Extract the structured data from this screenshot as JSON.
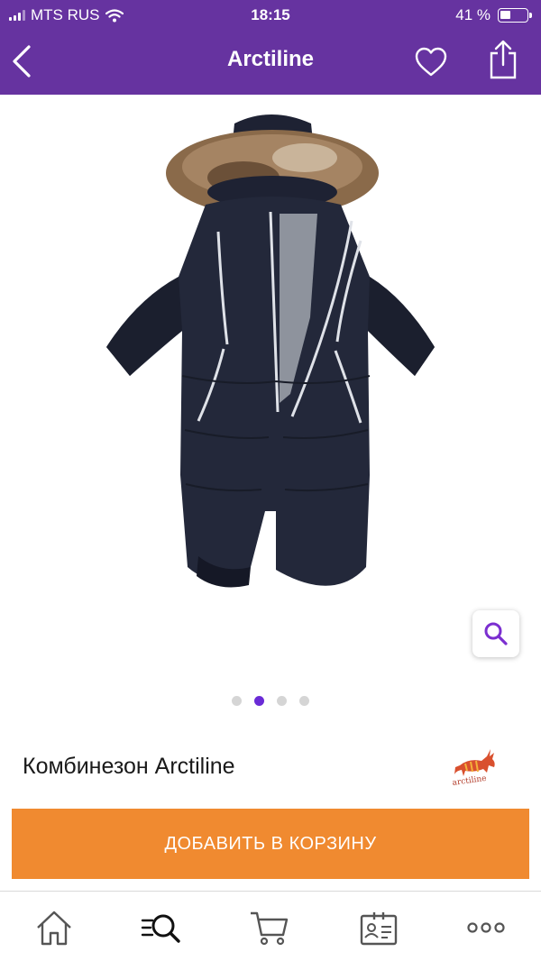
{
  "status_bar": {
    "carrier": "MTS RUS",
    "time": "18:15",
    "battery_percent": "41 %",
    "battery_level": 0.41
  },
  "nav": {
    "title": "Arctiline",
    "back_icon": "chevron-left-icon",
    "favorite_icon": "heart-icon",
    "share_icon": "share-icon"
  },
  "gallery": {
    "image_subject": "kids-winter-snowsuit",
    "slides": [
      "1",
      "2",
      "3",
      "4"
    ],
    "active_slide": 2,
    "zoom_icon": "magnifier-icon"
  },
  "product": {
    "title": "Комбинезон Arctiline",
    "brand_logo_text": "arctiline"
  },
  "cart_button": {
    "label": "ДОБАВИТЬ В КОРЗИНУ"
  },
  "tab_bar": {
    "items": [
      {
        "icon": "home-icon"
      },
      {
        "icon": "catalog-search-icon",
        "active": true
      },
      {
        "icon": "cart-icon"
      },
      {
        "icon": "profile-card-icon"
      },
      {
        "icon": "more-dots-icon"
      }
    ]
  },
  "colors": {
    "header": "#6633a0",
    "accent": "#6a2bd6",
    "cart_button": "#f08a30",
    "tab_icon": "#555555"
  }
}
